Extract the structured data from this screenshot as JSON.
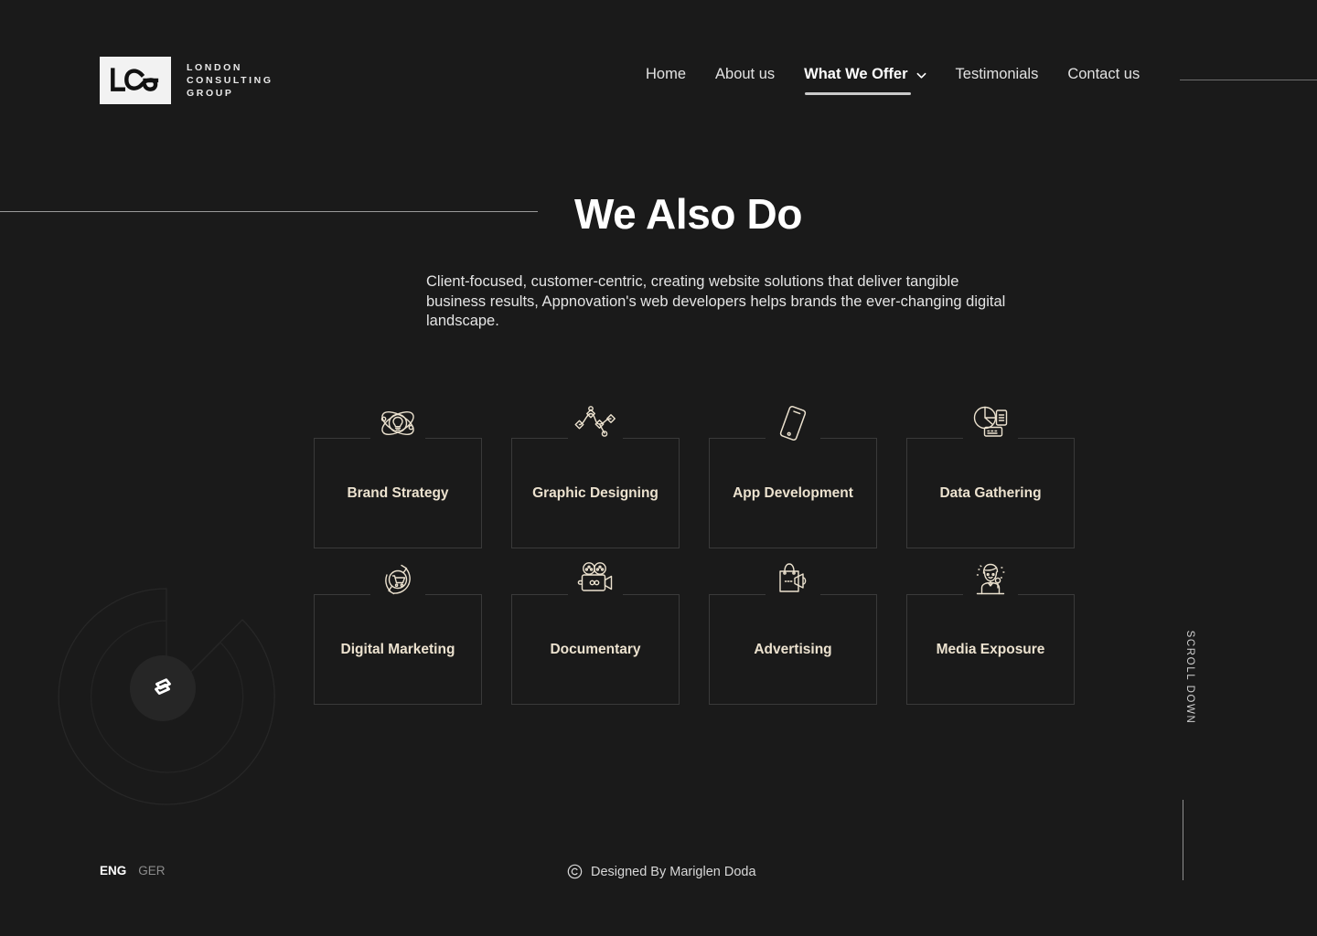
{
  "brand": {
    "monogram": "LCG",
    "name_lines": [
      "LONDON",
      "CONSULTING",
      "GROUP"
    ],
    "mark_icon": "abstract-layered-diamond-logo"
  },
  "nav": {
    "items": [
      {
        "label": "Home",
        "active": false,
        "has_dropdown": false
      },
      {
        "label": "About us",
        "active": false,
        "has_dropdown": false
      },
      {
        "label": "What We Offer",
        "active": true,
        "has_dropdown": true
      },
      {
        "label": "Testimonials",
        "active": false,
        "has_dropdown": false
      },
      {
        "label": "Contact us",
        "active": false,
        "has_dropdown": false
      }
    ],
    "dropdown_icon": "chevron-down-icon"
  },
  "hero": {
    "title": "We Also Do",
    "intro": "Client-focused, customer-centric, creating website solutions that deliver tangible business results, Appnovation's web developers helps brands the ever-changing digital landscape."
  },
  "services": [
    {
      "label": "Brand Strategy",
      "icon": "atom-lightbulb-icon"
    },
    {
      "label": "Graphic Designing",
      "icon": "node-graph-icon"
    },
    {
      "label": "App Development",
      "icon": "smartphone-icon"
    },
    {
      "label": "Data Gathering",
      "icon": "pie-chart-document-icon"
    },
    {
      "label": "Digital Marketing",
      "icon": "shopping-cart-cycle-icon"
    },
    {
      "label": "Documentary",
      "icon": "film-camera-icon"
    },
    {
      "label": "Advertising",
      "icon": "shopping-bag-megaphone-icon"
    },
    {
      "label": "Media Exposure",
      "icon": "presenter-microphone-icon"
    }
  ],
  "scroll": {
    "label": "SCROLL DOWN"
  },
  "footer": {
    "languages": [
      {
        "code": "ENG",
        "active": true
      },
      {
        "code": "GER",
        "active": false
      }
    ],
    "credit": "Designed By Mariglen Doda",
    "credit_icon": "copyright-icon"
  },
  "colors": {
    "background": "#1a1a1a",
    "accent_cream": "#ece2cf",
    "text_primary": "#ffffff",
    "text_muted": "#8c8c8c",
    "card_border": "#3a3a3a"
  }
}
